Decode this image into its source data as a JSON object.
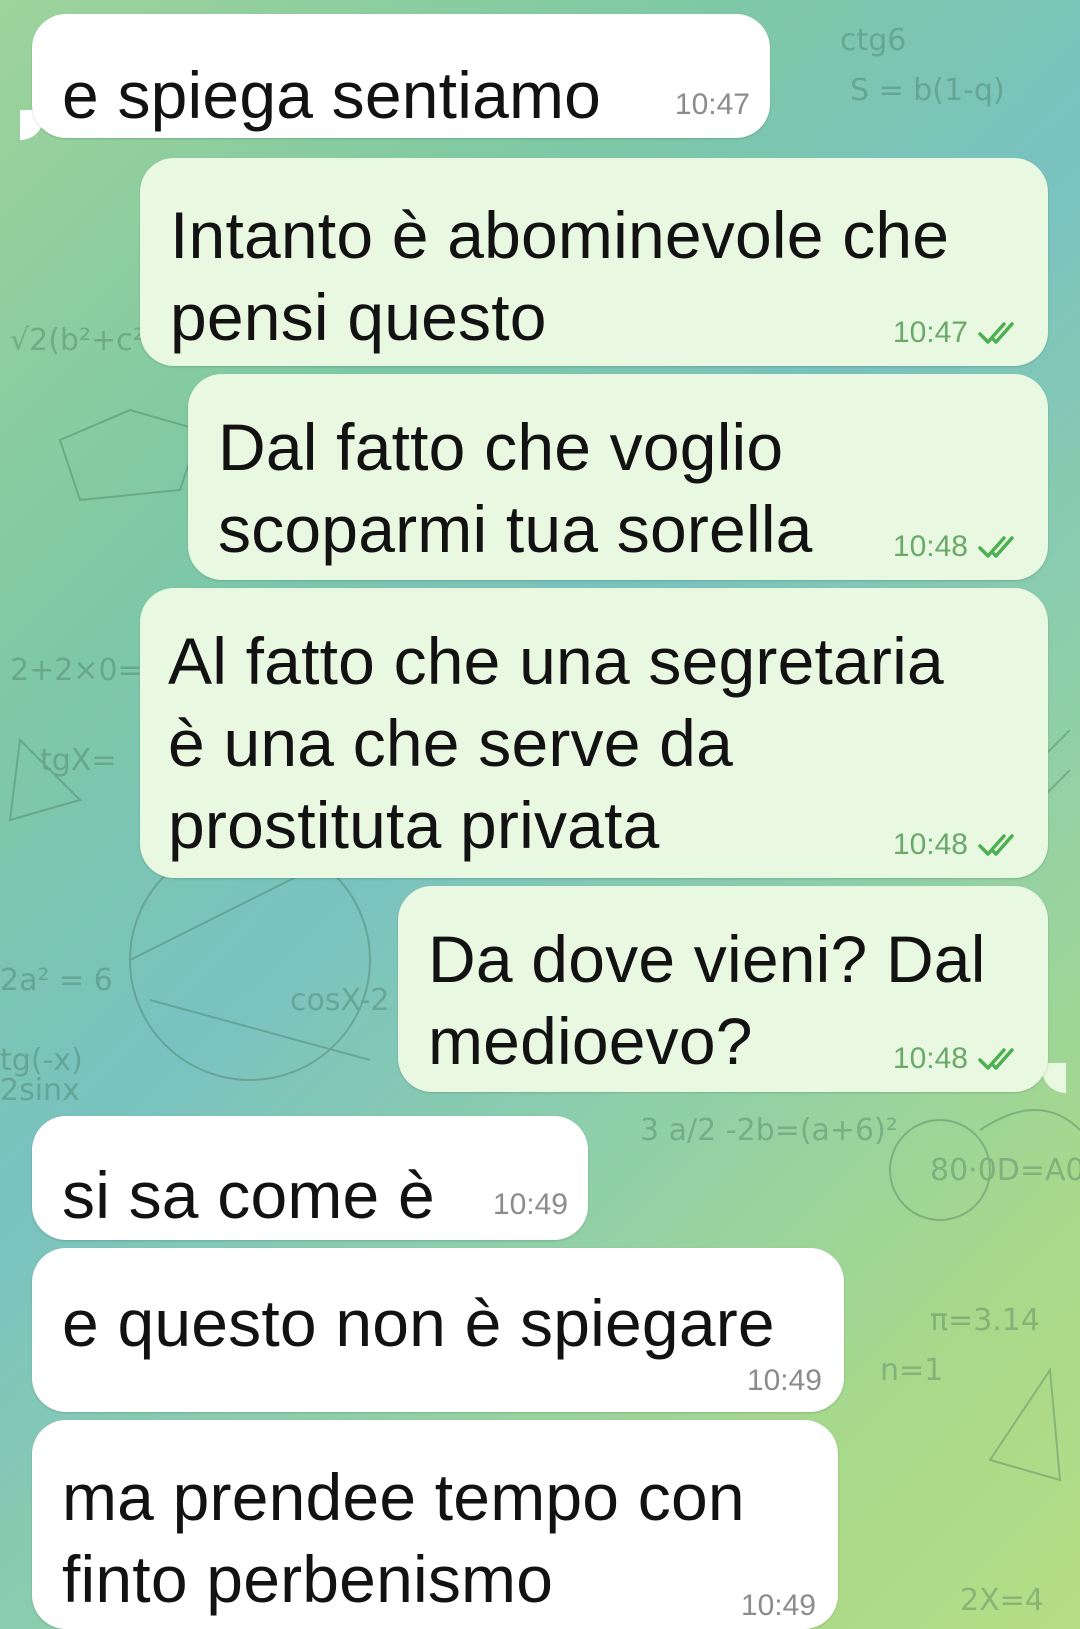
{
  "messages": [
    {
      "id": "m1",
      "direction": "in",
      "text": "e spiega sentiamo",
      "time": "10:47"
    },
    {
      "id": "m2",
      "direction": "out",
      "text": "Intanto è abominevole che\npensi questo",
      "time": "10:47",
      "status": "read"
    },
    {
      "id": "m3",
      "direction": "out",
      "text": "Dal fatto che voglio\nscoparmi tua sorella",
      "time": "10:48",
      "status": "read"
    },
    {
      "id": "m4",
      "direction": "out",
      "text": "Al fatto che una segretaria\nè una che serve da\nprostituta privata",
      "time": "10:48",
      "status": "read"
    },
    {
      "id": "m5",
      "direction": "out",
      "text": "Da dove vieni? Dal\nmedioevo?",
      "time": "10:48",
      "status": "read"
    },
    {
      "id": "m6",
      "direction": "in",
      "text": "si sa come è",
      "time": "10:49"
    },
    {
      "id": "m7",
      "direction": "in",
      "text": "e questo non è spiegare",
      "time": "10:49"
    },
    {
      "id": "m8",
      "direction": "in",
      "text": "ma prendee tempo con\nfinto perbenismo",
      "time": "10:49"
    }
  ],
  "colors": {
    "incoming_bubble": "#ffffff",
    "outgoing_bubble": "#e9f8e1",
    "read_ticks": "#4caf50",
    "time_outgoing": "#6aa96a",
    "time_incoming": "#8c8c8c"
  },
  "icons": {
    "read_status": "double-check-icon",
    "background": "math-doodle-wallpaper"
  }
}
